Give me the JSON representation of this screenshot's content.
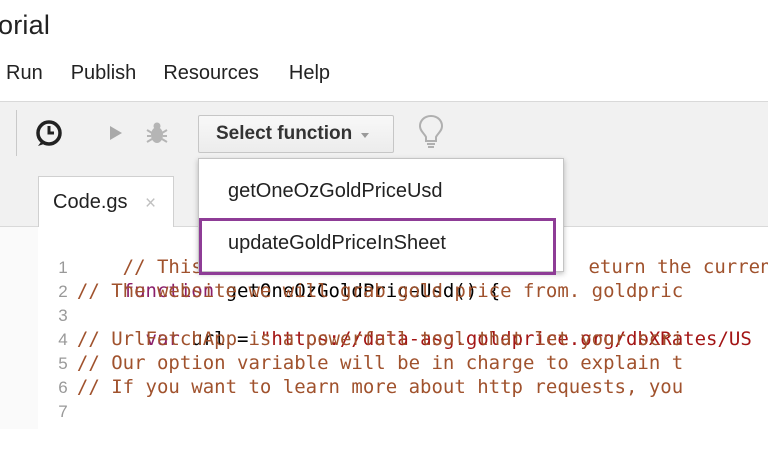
{
  "window": {
    "title": "orial"
  },
  "menu": {
    "run": "Run",
    "publish": "Publish",
    "resources": "Resources",
    "help": "Help"
  },
  "toolbar": {
    "icons": [
      "clock-icon",
      "run-icon",
      "bug-icon",
      "lightbulb-icon"
    ],
    "select_function_label": "Select function"
  },
  "tabs": [
    {
      "label": "Code.gs",
      "close": "×"
    }
  ],
  "dropdown": {
    "items": [
      "getOneOzGoldPriceUsd",
      "updateGoldPriceInSheet"
    ],
    "highlighted_index": 1,
    "highlight_color": "#8e3c96"
  },
  "editor": {
    "lines": [
      {
        "n": "1",
        "text": "// This fun",
        "text2": "eturn the curren"
      },
      {
        "n": "2",
        "kw": "function",
        "rest": " getOneOzGoldPriceUsd() {"
      },
      {
        "n": "3",
        "text": "  // The website we will grab gold price from. goldpric"
      },
      {
        "n": "4",
        "kw": "  var",
        "mid": " url = ",
        "str": "\"https://data-asg.goldprice.org/dbXRates/US"
      },
      {
        "n": "5",
        "text": "  // UrlFetchApp is a powerfull tool that let your scri"
      },
      {
        "n": "6",
        "text": "  // Our option variable will be in charge to explain t"
      },
      {
        "n": "7",
        "text": "  // If you want to learn more about http requests, you"
      }
    ]
  },
  "colors": {
    "comment": "#a0522d",
    "keyword": "#8b1f6b",
    "string": "#a31515"
  }
}
